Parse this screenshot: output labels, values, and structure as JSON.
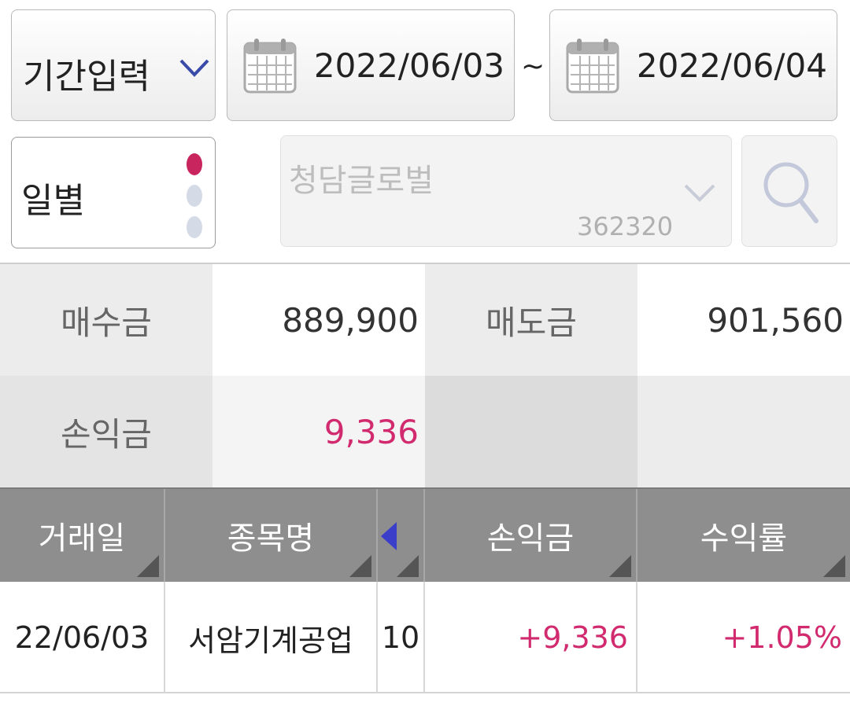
{
  "filters": {
    "period_label": "기간입력",
    "start_date": "2022/06/03",
    "separator": "~",
    "end_date": "2022/06/04",
    "unit_label": "일별",
    "stock_name": "청담글로벌",
    "stock_code": "362320"
  },
  "summary": {
    "buy_label": "매수금",
    "buy_value": "889,900",
    "sell_label": "매도금",
    "sell_value": "901,560",
    "pnl_label": "손익금",
    "pnl_value": "9,336"
  },
  "table": {
    "headers": [
      "거래일",
      "종목명",
      "손익금",
      "수익률"
    ],
    "rows": [
      {
        "date": "22/06/03",
        "name": "서암기계공업",
        "qty": "10",
        "pnl": "+9,336",
        "rate": "+1.05%"
      }
    ]
  },
  "colors": {
    "accent_pink": "#d22a6e",
    "header_gray": "#8e8e8e",
    "arrow_blue": "#3b3ec8"
  },
  "icons": [
    "chevron-down-icon",
    "calendar-icon",
    "search-icon",
    "sort-triangle-icon",
    "left-arrow-icon"
  ]
}
